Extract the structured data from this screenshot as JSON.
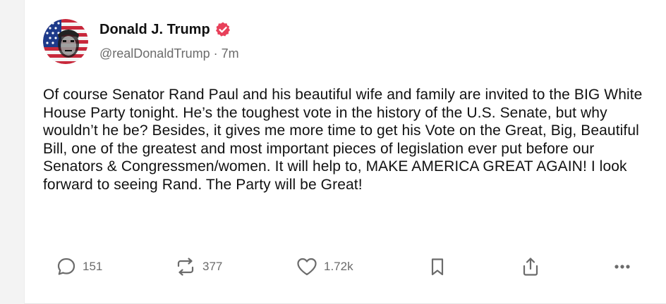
{
  "post": {
    "author": {
      "display_name": "Donald J. Trump",
      "handle": "@realDonaldTrump",
      "verified": true
    },
    "separator": "·",
    "timestamp": "7m",
    "text": "Of course Senator Rand Paul and his beautiful wife and family are invited to the BIG White House Party tonight. He’s the toughest vote in the history of the U.S. Senate, but why wouldn’t he be? Besides, it gives me more time to get his Vote on the Great, Big, Beautiful Bill, one of the greatest and most important pieces of legislation ever put before our Senators & Congressmen/women. It will help to, MAKE AMERICA GREAT AGAIN! I look forward to seeing Rand. The Party will be Great!",
    "stats": {
      "replies": "151",
      "reposts": "377",
      "likes": "1.72k"
    }
  },
  "icons": {
    "verified": "verified-badge-icon",
    "reply": "comment-bubble-icon",
    "repost": "repost-arrows-icon",
    "like": "heart-icon",
    "bookmark": "bookmark-icon",
    "share": "share-upload-icon",
    "more": "more-dots-icon"
  },
  "colors": {
    "verified_badge": "#e8405a",
    "text_primary": "#111111",
    "text_secondary": "#6b6b6b"
  }
}
